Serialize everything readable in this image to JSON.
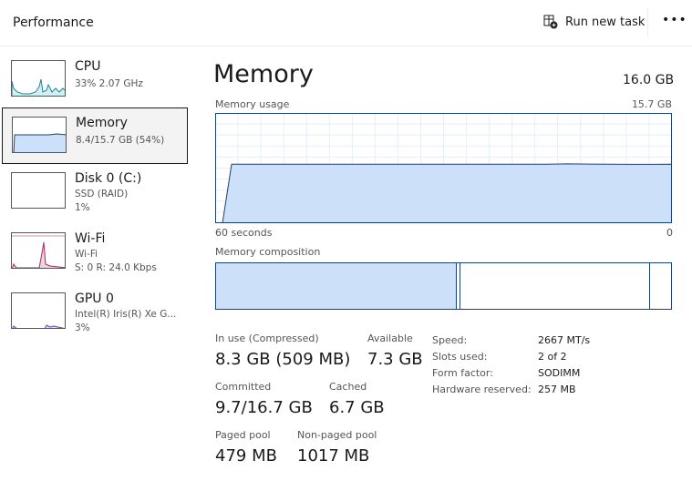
{
  "header": {
    "title": "Performance",
    "run_new_task": "Run new task",
    "more": "•••"
  },
  "sidebar": {
    "items": [
      {
        "name": "CPU",
        "line1": "33% 2.07 GHz",
        "line2": "",
        "color": "#17899b"
      },
      {
        "name": "Memory",
        "line1": "8.4/15.7 GB (54%)",
        "line2": "",
        "color": "#2a5fa8",
        "selected": true
      },
      {
        "name": "Disk 0 (C:)",
        "line1": "SSD (RAID)",
        "line2": "1%",
        "color": "#4f8a10"
      },
      {
        "name": "Wi-Fi",
        "line1": "Wi-Fi",
        "line2": "S: 0 R: 24.0 Kbps",
        "color": "#a72a5d"
      },
      {
        "name": "GPU 0",
        "line1": "Intel(R) Iris(R) Xe G...",
        "line2": "3%",
        "color": "#6a3fb0"
      }
    ]
  },
  "main": {
    "title": "Memory",
    "total": "16.0 GB",
    "usage_label": "Memory usage",
    "usage_max": "15.7 GB",
    "x_left": "60 seconds",
    "x_right": "0",
    "composition_label": "Memory composition",
    "composition": {
      "in_use_fraction": 0.53,
      "modified_fraction": 0.008,
      "standby_fraction": 0.415,
      "free_fraction": 0.047
    },
    "usage_gb_series": [
      0,
      8.4,
      8.4,
      8.4,
      8.4,
      8.4,
      8.4,
      8.4,
      8.4,
      8.4,
      8.4,
      8.4,
      8.4,
      8.4,
      8.4,
      8.4,
      8.4,
      8.45,
      8.42,
      8.4,
      8.38,
      8.38,
      8.4
    ],
    "stats": {
      "in_use_label": "In use (Compressed)",
      "in_use": "8.3 GB (509 MB)",
      "available_label": "Available",
      "available": "7.3 GB",
      "committed_label": "Committed",
      "committed": "9.7/16.7 GB",
      "cached_label": "Cached",
      "cached": "6.7 GB",
      "paged_label": "Paged pool",
      "paged": "479 MB",
      "nonpaged_label": "Non-paged pool",
      "nonpaged": "1017 MB"
    },
    "props": [
      {
        "k": "Speed:",
        "v": "2667 MT/s"
      },
      {
        "k": "Slots used:",
        "v": "2 of 2"
      },
      {
        "k": "Form factor:",
        "v": "SODIMM"
      },
      {
        "k": "Hardware reserved:",
        "v": "257 MB"
      }
    ]
  },
  "colors": {
    "memory_fill": "#cce0fa",
    "memory_line": "#1e3f73"
  }
}
